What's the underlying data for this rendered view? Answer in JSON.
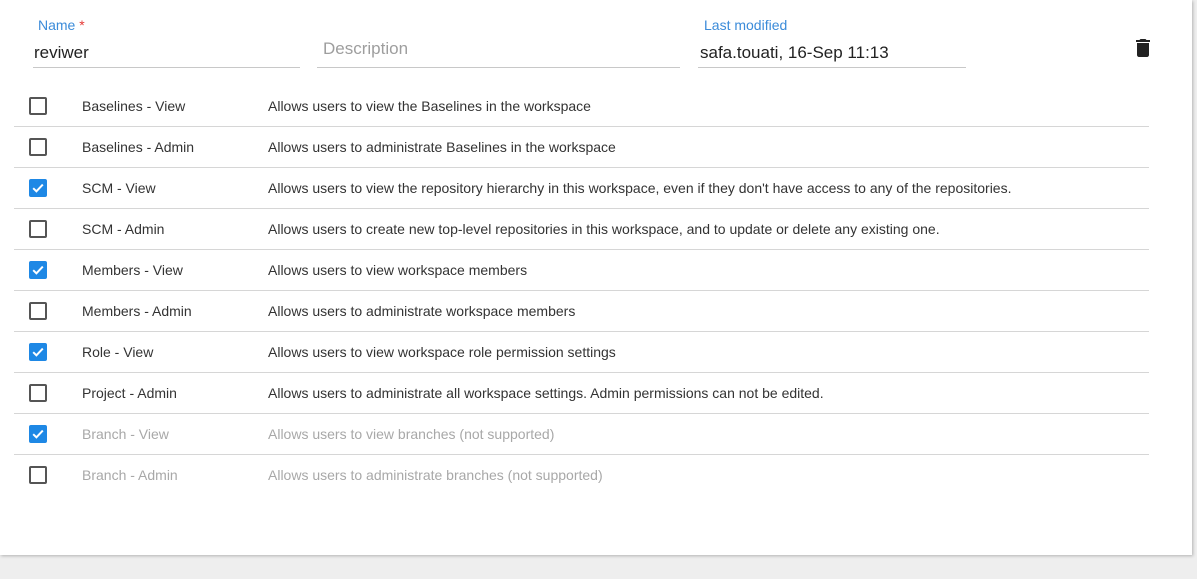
{
  "form": {
    "name_label": "Name",
    "required_mark": "*",
    "name_value": "reviwer",
    "description_placeholder": "Description",
    "last_modified_label": "Last modified",
    "last_modified_value": "safa.touati, 16-Sep 11:13",
    "delete_icon": "trash-icon"
  },
  "colors": {
    "accent": "#1e88e5",
    "label": "#3b8bd9",
    "required": "#e53935",
    "disabled_text": "#a8a8a8"
  },
  "permissions": [
    {
      "name": "Baselines - View",
      "description": "Allows users to view the Baselines in the workspace",
      "checked": false,
      "disabled": false
    },
    {
      "name": "Baselines - Admin",
      "description": "Allows users to administrate Baselines in the workspace",
      "checked": false,
      "disabled": false
    },
    {
      "name": "SCM - View",
      "description": "Allows users to view the repository hierarchy in this workspace, even if they don't have access to any of the repositories.",
      "checked": true,
      "disabled": false
    },
    {
      "name": "SCM - Admin",
      "description": "Allows users to create new top-level repositories in this workspace, and to update or delete any existing one.",
      "checked": false,
      "disabled": false
    },
    {
      "name": "Members - View",
      "description": "Allows users to view workspace members",
      "checked": true,
      "disabled": false
    },
    {
      "name": "Members - Admin",
      "description": "Allows users to administrate workspace members",
      "checked": false,
      "disabled": false
    },
    {
      "name": "Role - View",
      "description": "Allows users to view workspace role permission settings",
      "checked": true,
      "disabled": false
    },
    {
      "name": "Project - Admin",
      "description": "Allows users to administrate all workspace settings. Admin permissions can not be edited.",
      "checked": false,
      "disabled": false
    },
    {
      "name": "Branch - View",
      "description": "Allows users to view branches (not supported)",
      "checked": true,
      "disabled": true
    },
    {
      "name": "Branch - Admin",
      "description": "Allows users to administrate branches (not supported)",
      "checked": false,
      "disabled": true
    }
  ]
}
